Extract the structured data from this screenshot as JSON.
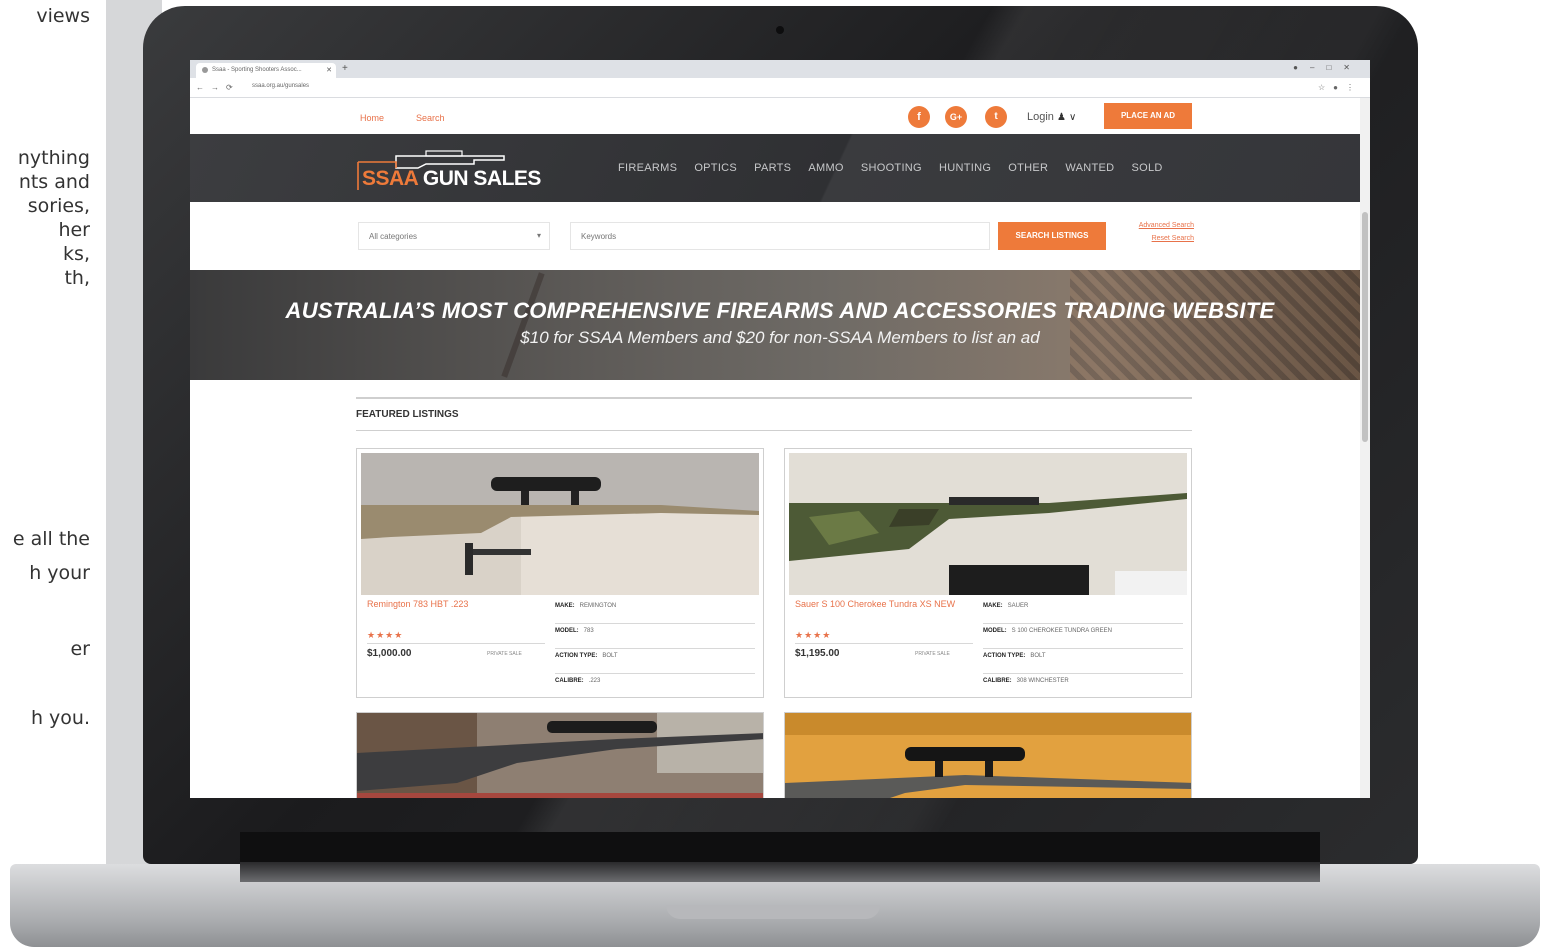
{
  "left_page": {
    "fragments": [
      "views",
      "nything",
      "nts and",
      "sories,",
      "her",
      "ks,",
      "th,",
      "e all the",
      "h your",
      "er",
      "h you."
    ]
  },
  "browser": {
    "tab_title": "Ssaa - Sporting Shooters Assoc...",
    "url": "ssaa.org.au/gunsales"
  },
  "site": {
    "breadcrumb": {
      "home": "Home",
      "search": "Search"
    },
    "social": {
      "facebook": "f",
      "google": "G+",
      "twitter": "t"
    },
    "login_label": "Login",
    "place_ad": "PLACE AN AD",
    "logo": {
      "ssaa": "SSAA",
      "rest": "GUN SALES"
    },
    "nav": [
      "FIREARMS",
      "OPTICS",
      "PARTS",
      "AMMO",
      "SHOOTING",
      "HUNTING",
      "OTHER",
      "WANTED",
      "SOLD"
    ],
    "search": {
      "category_value": "All categories",
      "keywords_placeholder": "Keywords",
      "button": "SEARCH LISTINGS",
      "advanced": "Advanced Search",
      "reset": "Reset Search"
    },
    "hero": {
      "title": "AUSTRALIA’S MOST COMPREHENSIVE FIREARMS AND ACCESSORIES TRADING WEBSITE",
      "subtitle": "$10 for SSAA Members and $20 for non-SSAA Members to list an ad"
    },
    "featured_title": "FEATURED LISTINGS",
    "listings": [
      {
        "title": "Remington 783 HBT .223",
        "stars": "★★★★",
        "price": "$1,000.00",
        "seller": "PRIVATE SALE",
        "specs": [
          {
            "label": "MAKE:",
            "value": "REMINGTON"
          },
          {
            "label": "MODEL:",
            "value": "783"
          },
          {
            "label": "ACTION TYPE:",
            "value": "BOLT"
          },
          {
            "label": "CALIBRE:",
            "value": ".223"
          }
        ]
      },
      {
        "title": "Sauer S 100 Cherokee Tundra XS NEW",
        "stars": "★★★★",
        "price": "$1,195.00",
        "seller": "PRIVATE SALE",
        "specs": [
          {
            "label": "MAKE:",
            "value": "SAUER"
          },
          {
            "label": "MODEL:",
            "value": "S 100 CHEROKEE TUNDRA GREEN"
          },
          {
            "label": "ACTION TYPE:",
            "value": "BOLT"
          },
          {
            "label": "CALIBRE:",
            "value": "308 WINCHESTER"
          }
        ]
      }
    ]
  },
  "colors": {
    "accent": "#ee7a3a",
    "nav_bg": "#333438"
  }
}
